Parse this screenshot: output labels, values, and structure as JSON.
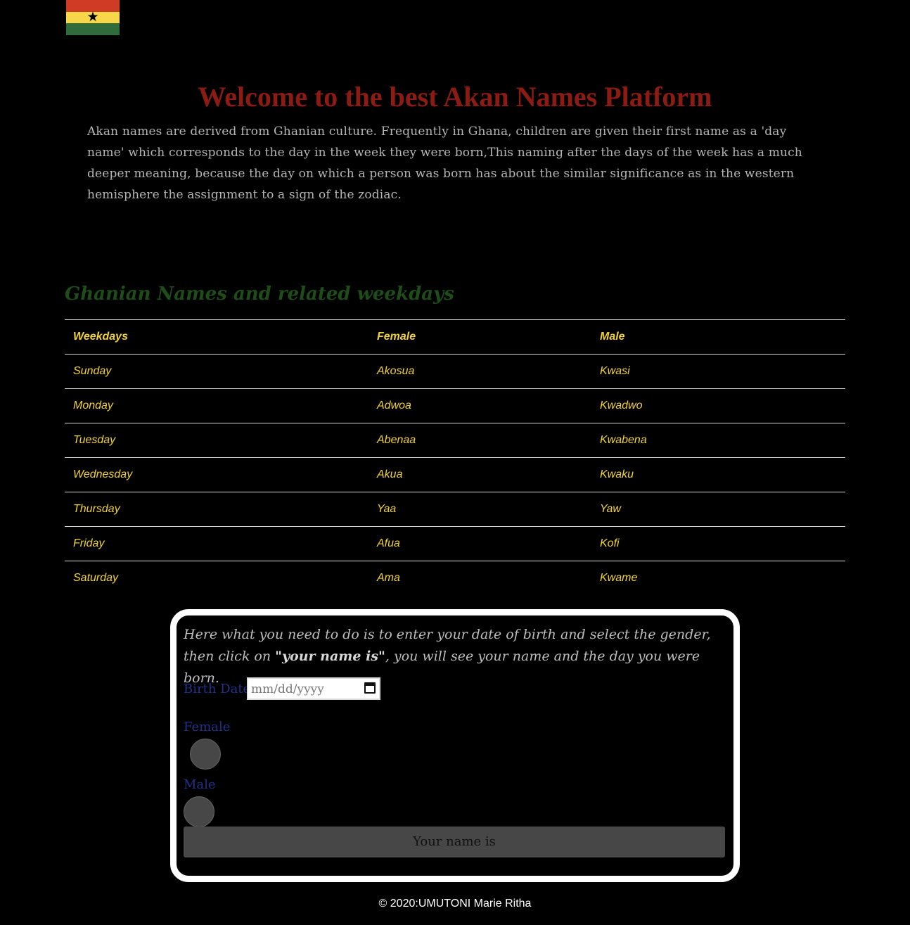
{
  "title": "Welcome to the best Akan Names Platform",
  "intro": "Akan names are derived from Ghanian culture. Frequently in Ghana, children are given their first name as a 'day name' which corresponds to the day in the week they were born,This naming after the days of the week has a much deeper meaning, because the day on which a person was born has about the similar significance as in the western hemisphere the assignment to a sign of the zodiac.",
  "section_title": "Ghanian Names and related weekdays",
  "table": {
    "headers": [
      "Weekdays",
      "Female",
      "Male"
    ],
    "rows": [
      [
        "Sunday",
        "Akosua",
        "Kwasi"
      ],
      [
        "Monday",
        "Adwoa",
        "Kwadwo"
      ],
      [
        "Tuesday",
        "Abenaa",
        "Kwabena"
      ],
      [
        "Wednesday",
        "Akua",
        "Kwaku"
      ],
      [
        "Thursday",
        "Yaa",
        "Yaw"
      ],
      [
        "Friday",
        "Afua",
        "Kofi"
      ],
      [
        "Saturday",
        "Ama",
        "Kwame"
      ]
    ]
  },
  "form": {
    "instruction_start": "Here what you need to do is to enter your date of birth and select the gender, then click on ",
    "instruction_bold": "\"your name is\"",
    "instruction_end": ", you will see your name and the day you were born.",
    "birth_label": "Birth Date",
    "date_placeholder": "mm/dd/yyyy",
    "female_label": "Female",
    "male_label": "Male",
    "submit_label": "Your name is"
  },
  "footer": "© 2020:UMUTONI Marie Ritha",
  "colors": {
    "title": "#8c1c13",
    "section_title": "#1e4d1a",
    "table_text": "#f2d233",
    "form_labels": "#22328a",
    "flag_red": "#cf3b25",
    "flag_gold": "#f8d64a",
    "flag_green": "#2f6b3b"
  },
  "icons": {
    "flag": "ghana-flag-icon",
    "calendar": "calendar-icon"
  }
}
